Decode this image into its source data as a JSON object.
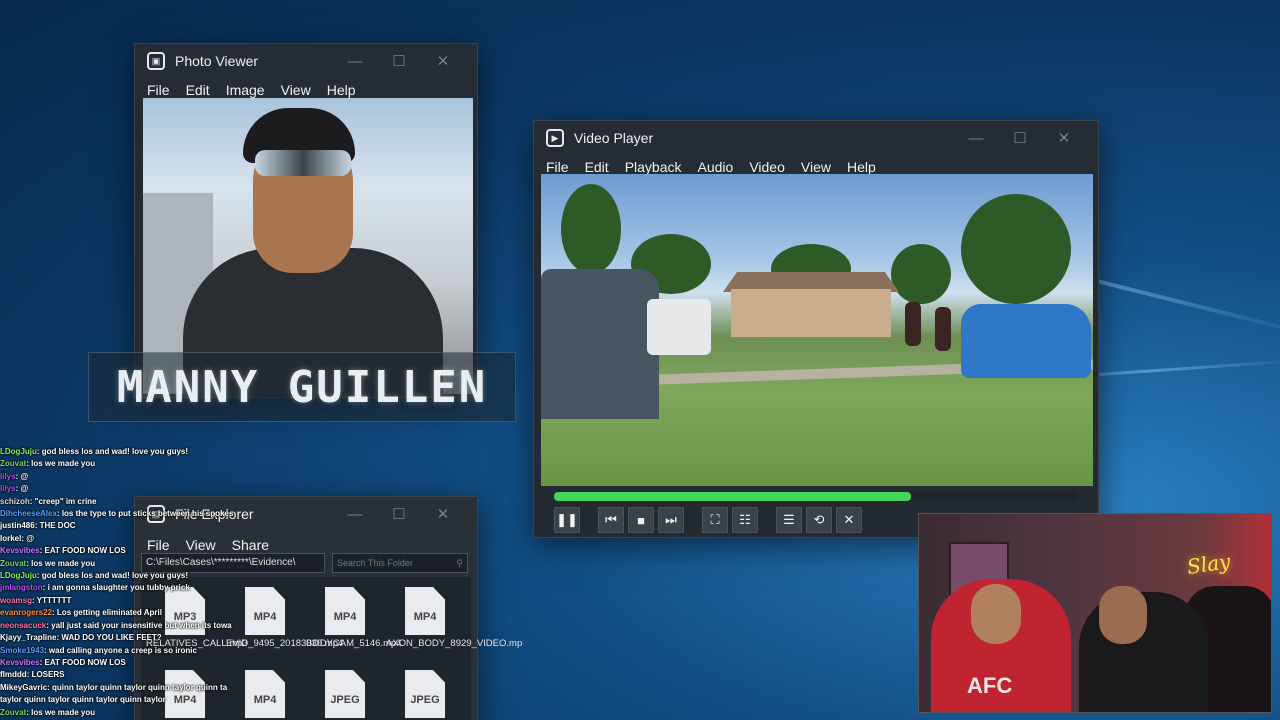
{
  "photo_viewer": {
    "title": "Photo Viewer",
    "menu": [
      "File",
      "Edit",
      "Image",
      "View",
      "Help"
    ]
  },
  "name_plate": "MANNY GUILLEN",
  "video_player": {
    "title": "Video Player",
    "menu": [
      "File",
      "Edit",
      "Playback",
      "Audio",
      "Video",
      "View",
      "Help"
    ],
    "progress_percent": 68
  },
  "file_explorer": {
    "title": "File Explorer",
    "menu": [
      "File",
      "View",
      "Share"
    ],
    "path": "C:\\Files\\Cases\\*********\\Evidence\\",
    "search_placeholder": "Search This Folder",
    "files": [
      {
        "type": "MP3",
        "name": "RELATIVES_CALL.mp3"
      },
      {
        "type": "MP4",
        "name": "EVID_9495_20183030.mp4"
      },
      {
        "type": "MP4",
        "name": "BODYCAM_5146.mp4"
      },
      {
        "type": "MP4",
        "name": "AXON_BODY_8929_VIDEO.mp"
      },
      {
        "type": "MP4",
        "name": ""
      },
      {
        "type": "MP4",
        "name": ""
      },
      {
        "type": "JPEG",
        "name": ""
      },
      {
        "type": "JPEG",
        "name": ""
      }
    ]
  },
  "chat": [
    {
      "user": "LDogJuju",
      "color": "#8cf05a",
      "text": "god bless los and wad! love you guys!"
    },
    {
      "user": "Zouvat",
      "color": "#7cd45a",
      "text": "los we made you"
    },
    {
      "user": "lilys",
      "color": "#b54cf0",
      "text": "@"
    },
    {
      "user": "lilys",
      "color": "#b54cf0",
      "text": "@"
    },
    {
      "user": "schizoh",
      "color": "#dddddd",
      "text": "\"creep\" im crine"
    },
    {
      "user": "DihcheeseAlex",
      "color": "#5aa0ff",
      "text": "los the type to put sticks between his spokes"
    },
    {
      "user": "justin486",
      "color": "#ffffff",
      "text": "THE DOC"
    },
    {
      "user": "lorkel",
      "color": "#ffffff",
      "text": "@"
    },
    {
      "user": "Kevsvibes",
      "color": "#d070ff",
      "text": "EAT FOOD NOW LOS"
    },
    {
      "user": "Zouvat",
      "color": "#7cd45a",
      "text": "los we made you"
    },
    {
      "user": "LDogJuju",
      "color": "#8cf05a",
      "text": "god bless los and wad! love you guys!"
    },
    {
      "user": "jmlangston",
      "color": "#b54cf0",
      "text": "i am gonna slaughter you tubby prick"
    },
    {
      "user": "woamsg",
      "color": "#ff6fa8",
      "text": "YTTTTTT"
    },
    {
      "user": "evanrogers22",
      "color": "#ff8a3a",
      "text": "Los getting eliminated April"
    },
    {
      "user": "neonsacuck",
      "color": "#ff6fa8",
      "text": "yall just said your insensitive but when its towa"
    },
    {
      "user": "Kjayy_Trapline",
      "color": "#ffffff",
      "text": "WAD DO YOU LIKE FEET?"
    },
    {
      "user": "Smoke1943",
      "color": "#5aa0ff",
      "text": "wad calling anyone a creep is so ironic"
    },
    {
      "user": "Kevsvibes",
      "color": "#d070ff",
      "text": "EAT FOOD NOW LOS"
    },
    {
      "user": "flmddd",
      "color": "#ffffff",
      "text": "LOSERS"
    },
    {
      "user": "MikeyGavric",
      "color": "#ffffff",
      "text": "quinn taylor quinn taylor quinn taylor quinn ta"
    },
    {
      "user": "",
      "color": "#ffffff",
      "text": "taylor quinn taylor quinn taylor quinn taylor"
    },
    {
      "user": "Zouvat",
      "color": "#7cd45a",
      "text": "los we made you"
    }
  ],
  "webcam": {
    "neon_sign": "Slay",
    "shirt_text": "AFC"
  },
  "icons": {
    "play_pause": "pause-icon",
    "prev": "skip-back-icon",
    "stop": "stop-icon",
    "next": "skip-forward-icon",
    "fullscreen": "fullscreen-icon",
    "equalizer": "equalizer-icon",
    "playlist": "playlist-icon",
    "loop": "loop-icon",
    "close": "close-icon"
  }
}
